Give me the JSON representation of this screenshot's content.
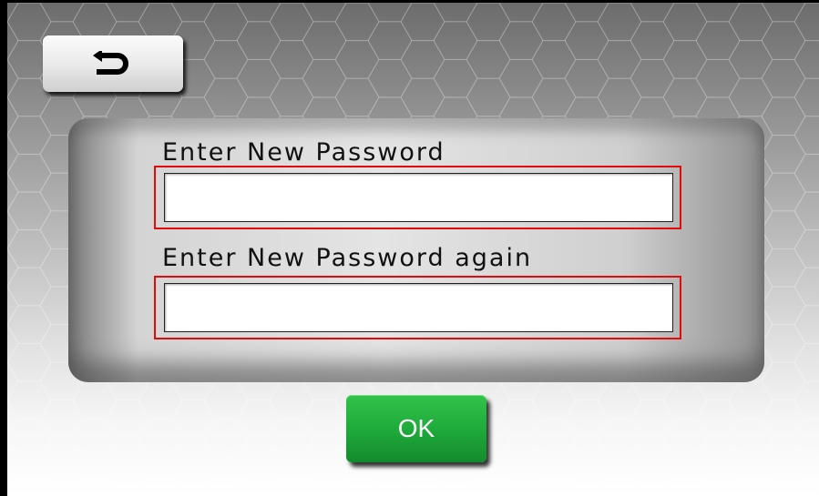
{
  "toolbar": {
    "back_icon": "return-arrow-icon"
  },
  "form": {
    "new_password_label": "Enter New Password",
    "new_password_value": "",
    "new_password_placeholder": "",
    "confirm_password_label": "Enter New Password again",
    "confirm_password_value": "",
    "confirm_password_placeholder": ""
  },
  "actions": {
    "ok_label": "OK"
  },
  "colors": {
    "ok_button": "#1ea83a",
    "field_highlight": "#e20b0b",
    "panel": "#d4d4d4"
  }
}
